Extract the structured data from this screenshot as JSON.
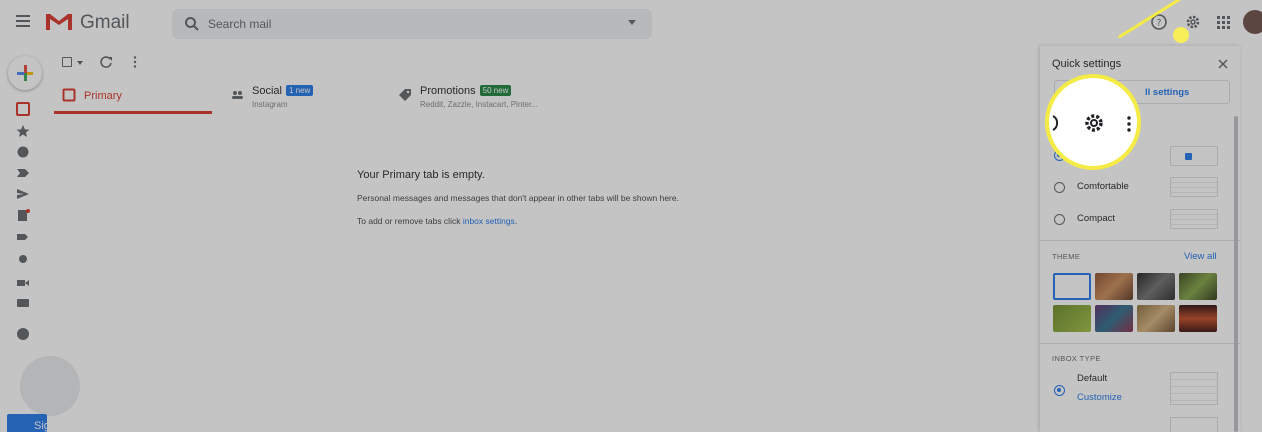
{
  "header": {
    "logo_text": "Gmail",
    "search_placeholder": "Search mail"
  },
  "tabs": [
    {
      "label": "Primary",
      "sub": ""
    },
    {
      "label": "Social",
      "badge": "1 new",
      "badge_color": "#1a73e8",
      "sub": "Instagram"
    },
    {
      "label": "Promotions",
      "badge": "50 new",
      "badge_color": "#188038",
      "sub": "Reddit, Zazzle, Instacart, Pinter..."
    }
  ],
  "empty_state": {
    "title": "Your Primary tab is empty.",
    "description": "Personal messages and messages that don't appear in other tabs will be shown here.",
    "add_prefix": "To add or remove tabs click ",
    "add_link": "inbox settings",
    "add_suffix": "."
  },
  "quick_settings": {
    "title": "Quick settings",
    "all_settings_label": "ll settings",
    "density_options": [
      "Comfortable",
      "Compact"
    ],
    "theme_label": "THEME",
    "view_all": "View all",
    "inbox_type_label": "INBOX TYPE",
    "inbox_default": "Default",
    "customize": "Customize"
  },
  "left_rail": {
    "sign_label": "Sig"
  },
  "colors": {
    "accent": "#1a73e8",
    "primary_red": "#d93025",
    "highlight": "#f4ec45"
  },
  "icons": [
    "menu-icon",
    "gmail-logo-icon",
    "search-icon",
    "help-icon",
    "gear-icon",
    "apps-icon",
    "close-icon",
    "refresh-icon",
    "more-vert-icon"
  ]
}
